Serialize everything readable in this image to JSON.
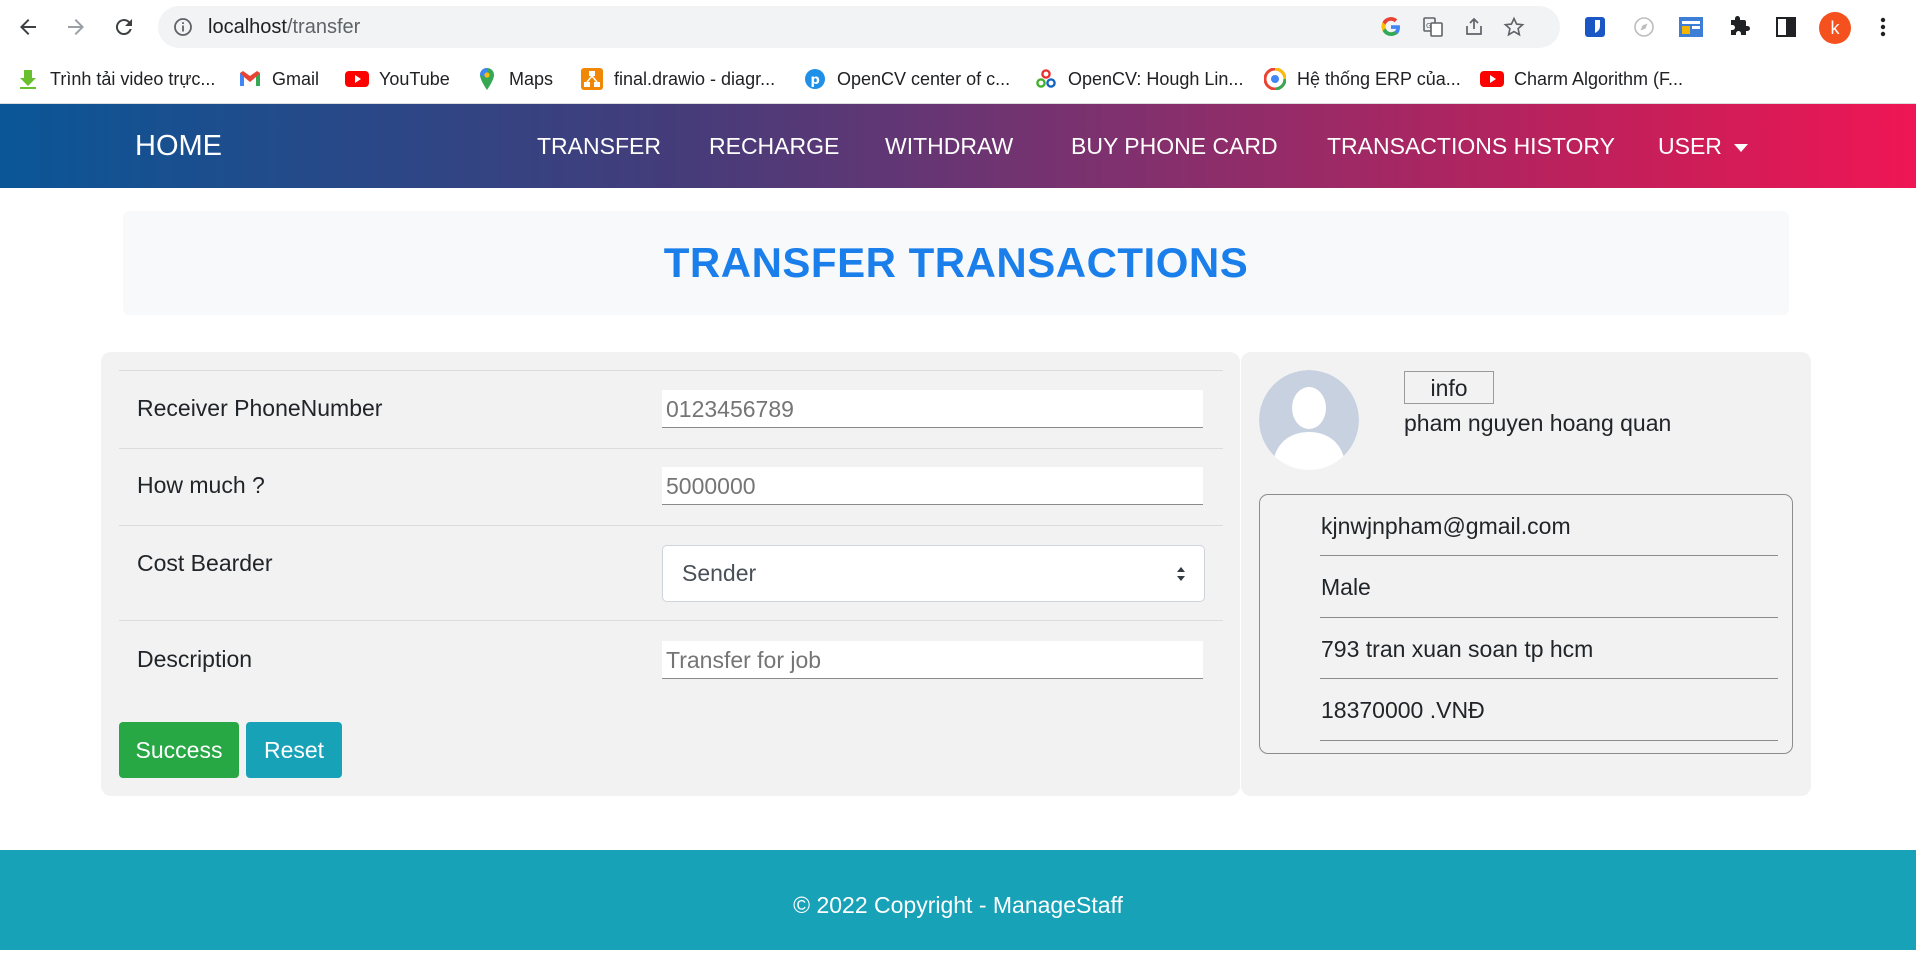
{
  "browser": {
    "url_host": "localhost",
    "url_path": "/transfer",
    "profile_initial": "k",
    "bookmarks": [
      {
        "label": "Trình tải video trực...",
        "icon": "download-arrow-icon"
      },
      {
        "label": "Gmail",
        "icon": "gmail-icon"
      },
      {
        "label": "YouTube",
        "icon": "youtube-icon"
      },
      {
        "label": "Maps",
        "icon": "maps-icon"
      },
      {
        "label": "final.drawio - diagr...",
        "icon": "drawio-icon"
      },
      {
        "label": "OpenCV center of c...",
        "icon": "p-logo-icon"
      },
      {
        "label": "OpenCV: Hough Lin...",
        "icon": "opencv-icon"
      },
      {
        "label": "Hệ thống ERP của...",
        "icon": "erp-icon"
      },
      {
        "label": "Charm Algorithm (F...",
        "icon": "youtube-icon"
      }
    ]
  },
  "navbar": {
    "brand": "HOME",
    "items": [
      "TRANSFER",
      "RECHARGE",
      "WITHDRAW",
      "BUY PHONE CARD",
      "TRANSACTIONS HISTORY",
      "USER"
    ]
  },
  "page": {
    "title": "TRANSFER TRANSACTIONS"
  },
  "form": {
    "receiver_label": "Receiver PhoneNumber",
    "receiver_placeholder": "0123456789",
    "amount_label": "How much ?",
    "amount_placeholder": "5000000",
    "cost_label": "Cost Bearder",
    "cost_selected": "Sender",
    "description_label": "Description",
    "description_placeholder": "Transfer for job",
    "submit_label": "Success",
    "reset_label": "Reset"
  },
  "profile": {
    "info_label": "info",
    "name": "pham nguyen hoang quan",
    "email": "kjnwjnpham@gmail.com",
    "gender": "Male",
    "address": "793 tran xuan soan tp hcm",
    "balance": "18370000 .VNĐ"
  },
  "footer": {
    "copyright": "© 2022 Copyright - ManageStaff"
  }
}
